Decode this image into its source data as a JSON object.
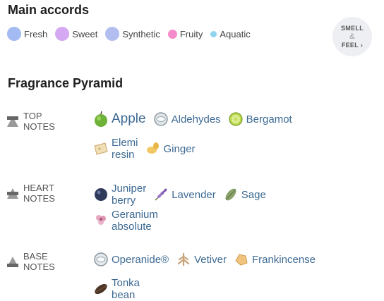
{
  "main_accords": {
    "title": "Main accords",
    "items": [
      {
        "label": "Fresh",
        "color": "#a3baf2",
        "size": 20
      },
      {
        "label": "Sweet",
        "color": "#d5a9f2",
        "size": 20
      },
      {
        "label": "Synthetic",
        "color": "#b2bef0",
        "size": 20
      },
      {
        "label": "Fruity",
        "color": "#f78ccb",
        "size": 13
      },
      {
        "label": "Aquatic",
        "color": "#8fd4ec",
        "size": 9
      }
    ]
  },
  "smell_feel": {
    "line1": "SMELL",
    "line2": "&",
    "line3": "FEEL",
    "arrow": "›"
  },
  "pyramid": {
    "title": "Fragrance Pyramid",
    "tiers": [
      {
        "label": "TOP NOTES",
        "rows": [
          [
            {
              "name": "Apple",
              "icon": "apple-icon",
              "big": true
            },
            {
              "name": "Aldehydes",
              "icon": "aldehydes-icon"
            },
            {
              "name": "Bergamot",
              "icon": "bergamot-icon"
            }
          ],
          [
            {
              "name": "Elemi resin",
              "icon": "elemi-resin-icon"
            },
            {
              "name": "Ginger",
              "icon": "ginger-icon"
            }
          ]
        ]
      },
      {
        "label": "HEART NOTES",
        "rows": [
          [
            {
              "name": "Juniper berry",
              "icon": "juniper-berry-icon"
            },
            {
              "name": "Lavender",
              "icon": "lavender-icon"
            },
            {
              "name": "Sage",
              "icon": "sage-icon"
            }
          ],
          [
            {
              "name": "Geranium absolute",
              "icon": "geranium-icon"
            }
          ]
        ]
      },
      {
        "label": "BASE NOTES",
        "rows": [
          [
            {
              "name": "Operanide®",
              "icon": "operanide-icon"
            },
            {
              "name": "Vetiver",
              "icon": "vetiver-icon"
            },
            {
              "name": "Frankincense",
              "icon": "frankincense-icon"
            }
          ],
          [
            {
              "name": "Tonka bean",
              "icon": "tonka-bean-icon"
            }
          ]
        ]
      }
    ]
  }
}
